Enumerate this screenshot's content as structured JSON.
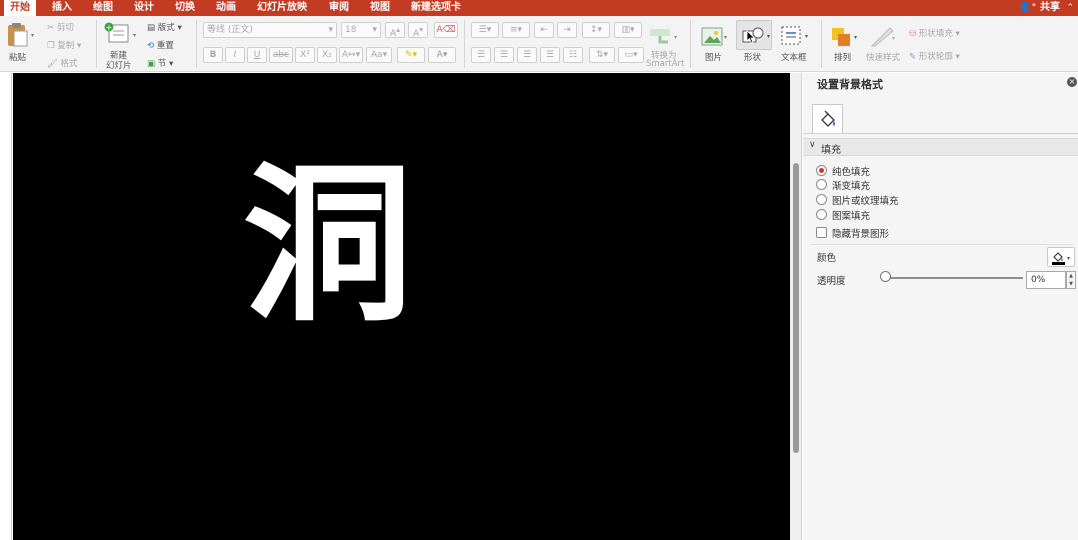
{
  "tabs": [
    {
      "label": "开始",
      "active": true
    },
    {
      "label": "插入"
    },
    {
      "label": "绘图"
    },
    {
      "label": "设计"
    },
    {
      "label": "切换"
    },
    {
      "label": "动画"
    },
    {
      "label": "幻灯片放映"
    },
    {
      "label": "审阅"
    },
    {
      "label": "视图"
    },
    {
      "label": "新建选项卡"
    }
  ],
  "share_label": "共享",
  "ribbon": {
    "paste": "粘贴",
    "cut": "剪切",
    "copy": "复制",
    "format": "格式",
    "new_slide_1": "新建",
    "new_slide_2": "幻灯片",
    "layout": "版式",
    "reset": "重置",
    "section": "节",
    "font_name": "等线 (正文)",
    "font_size": "18",
    "bold": "B",
    "italic": "I",
    "underline": "U",
    "strike": "abc",
    "superscript": "X²",
    "subscript": "X₂",
    "font_color": "A",
    "smartart_1": "转换为",
    "smartart_2": "SmartArt",
    "picture": "图片",
    "shapes": "形状",
    "textbox": "文本框",
    "arrange": "排列",
    "quick_styles": "快速样式",
    "shape_fill": "形状填充",
    "shape_outline": "形状轮廓"
  },
  "slide": {
    "text": "洞"
  },
  "pane": {
    "title": "设置背景格式",
    "section": "填充",
    "options": [
      {
        "label": "纯色填充",
        "selected": true
      },
      {
        "label": "渐变填充"
      },
      {
        "label": "图片或纹理填充"
      },
      {
        "label": "图案填充"
      }
    ],
    "hide_bg_label": "隐藏背景图形",
    "color_label": "颜色",
    "transparency_label": "透明度",
    "transparency_value": "0%"
  },
  "colors": {
    "accent": "#c33b22",
    "slide_bg": "#000000",
    "slide_text": "#ffffff"
  }
}
